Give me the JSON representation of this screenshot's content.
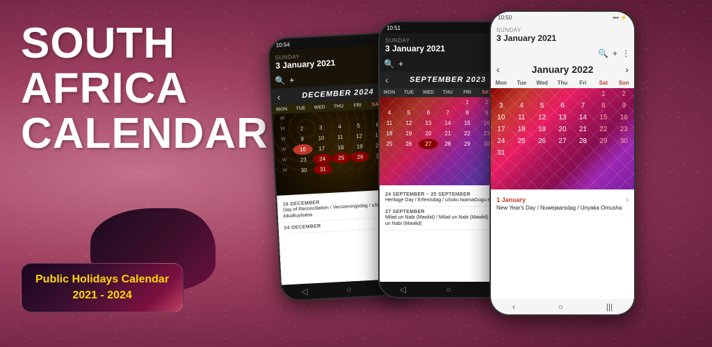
{
  "app": {
    "title": "South Africa Calendar",
    "title_line1": "SOUTH",
    "title_line2": "AFRICA",
    "title_line3": "CALENDAR",
    "subtitle_line1": "Public Holidays Calendar",
    "subtitle_line2": "2021 - 2024"
  },
  "phone1": {
    "status_time": "10:54",
    "date_label": "SUNDAY",
    "date_full": "3 January 2021",
    "month_title": "December 2024",
    "days": [
      "MON",
      "TUE",
      "WED",
      "THU",
      "FRI",
      "SAT"
    ],
    "event1_date": "16 December",
    "event1_name": "Day of Reconciliation / Versoeningsdag / uSuku lokuBuyisana",
    "event2_date": "24 December",
    "event2_name": ""
  },
  "phone2": {
    "status_time": "10:51",
    "date_label": "SUNDAY",
    "date_full": "3 January 2021",
    "month_title": "September 2023",
    "days": [
      "MON",
      "TUE",
      "WED",
      "THU",
      "FRI",
      "SAT"
    ],
    "event1_range": "24 September – 25 September",
    "event1_name": "Heritage Day / Erfenisdag / uSuku lwamaGugu esizwe",
    "event2_date": "27 September",
    "event2_name": "Milad un Nabi (Mawlid) / Milad un Nabi (Mawlid) / I-Milad un Nabi (Mawlid)"
  },
  "phone3": {
    "status_time": "10:50",
    "date_label": "Sunday",
    "date_full": "3 January 2021",
    "month_title": "January 2022",
    "days": [
      "Mon",
      "Tue",
      "Wed",
      "Thu",
      "Fri",
      "Sat",
      "Sun"
    ],
    "event1_date": "1 January",
    "event1_name": "New Year's Day / Nuwejaarsdag / Unyaka Omusha"
  }
}
